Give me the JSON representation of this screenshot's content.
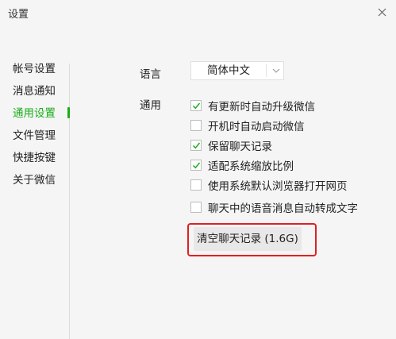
{
  "window": {
    "title": "设置"
  },
  "sidebar": {
    "items": [
      {
        "label": "帐号设置"
      },
      {
        "label": "消息通知"
      },
      {
        "label": "通用设置",
        "active": true
      },
      {
        "label": "文件管理"
      },
      {
        "label": "快捷按键"
      },
      {
        "label": "关于微信"
      }
    ]
  },
  "general": {
    "language_label": "语言",
    "language_value": "简体中文",
    "general_label": "通用",
    "options": [
      {
        "label": "有更新时自动升级微信",
        "checked": true
      },
      {
        "label": "开机时自动启动微信",
        "checked": false
      },
      {
        "label": "保留聊天记录",
        "checked": true
      },
      {
        "label": "适配系统缩放比例",
        "checked": true
      },
      {
        "label": "使用系统默认浏览器打开网页",
        "checked": false
      },
      {
        "label": "聊天中的语音消息自动转成文字",
        "checked": false
      }
    ],
    "clear_button_label": "清空聊天记录 (1.6G)"
  },
  "colors": {
    "accent": "#1aad19",
    "highlight": "#e02020"
  },
  "icons": {
    "close": "close-icon",
    "dropdown": "chevron-down-icon",
    "check": "check-icon"
  }
}
